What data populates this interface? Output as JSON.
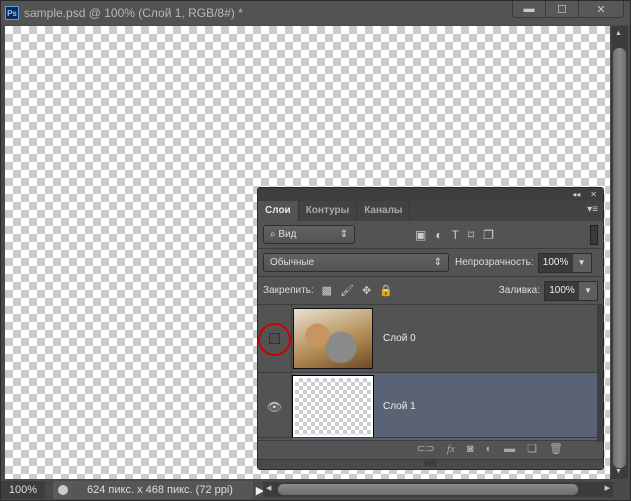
{
  "window": {
    "title": "sample.psd @ 100% (Слой 1, RGB/8#) *",
    "app_icon": "Ps",
    "minimize": "▬",
    "maximize": "☐",
    "close": "✕"
  },
  "status": {
    "zoom": "100%",
    "doc_info": "624 пикс. x 468 пикс. (72 ppi)"
  },
  "panel": {
    "collapse": "◂◂",
    "close": "✕",
    "menu": "▾≡",
    "tabs": [
      {
        "label": "Слои"
      },
      {
        "label": "Контуры"
      },
      {
        "label": "Каналы"
      }
    ],
    "filter": {
      "label": "Вид"
    },
    "blend_mode": "Обычные",
    "opacity_label": "Непрозрачность:",
    "opacity": "100%",
    "lock_label": "Закрепить:",
    "fill_label": "Заливка:",
    "fill": "100%",
    "layers": [
      {
        "name": "Слой 0",
        "visible": false
      },
      {
        "name": "Слой 1",
        "visible": true,
        "selected": true
      }
    ],
    "footer_fx": "fx"
  }
}
